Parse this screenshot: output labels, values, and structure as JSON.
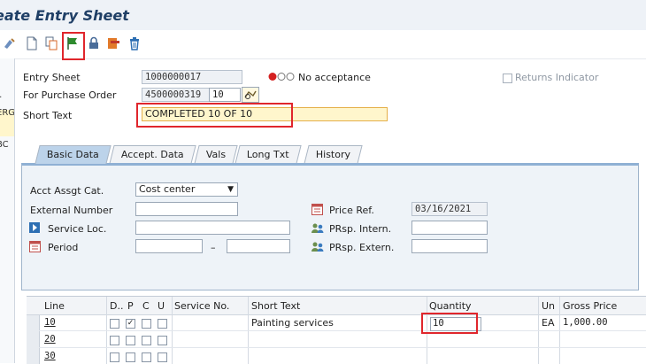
{
  "window": {
    "title": "eate Entry Sheet"
  },
  "left_panel": {
    "items": [
      "..",
      "ERG",
      "BC"
    ]
  },
  "header": {
    "entry_sheet_label": "Entry Sheet",
    "entry_sheet_value": "1000000017",
    "acceptance_status": "No acceptance",
    "returns_indicator_label": "Returns Indicator",
    "po_label": "For Purchase Order",
    "po_number": "4500000319",
    "po_item": "10",
    "short_text_label": "Short Text",
    "short_text_value": "COMPLETED 10 OF 10"
  },
  "tabs": [
    {
      "label": "Basic Data",
      "active": true
    },
    {
      "label": "Accept. Data",
      "active": false
    },
    {
      "label": "Vals",
      "active": false
    },
    {
      "label": "Long Txt",
      "active": false
    },
    {
      "label": "History",
      "active": false
    }
  ],
  "basic_data": {
    "acct_assgt_label": "Acct Assgt Cat.",
    "acct_assgt_value": "Cost center",
    "external_number_label": "External Number",
    "external_number_value": "",
    "service_loc_label": "Service Loc.",
    "service_loc_value": "",
    "period_label": "Period",
    "period_dash": "–",
    "period_from": "",
    "period_to": "",
    "price_ref_label": "Price Ref.",
    "price_ref_value": "03/16/2021",
    "prsp_intern_label": "PRsp. Intern.",
    "prsp_intern_value": "",
    "prsp_extern_label": "PRsp. Extern.",
    "prsp_extern_value": ""
  },
  "table": {
    "columns": [
      "Line",
      "D..",
      "P",
      "C",
      "U",
      "Service No.",
      "Short Text",
      "Quantity",
      "Un",
      "Gross Price"
    ],
    "rows": [
      {
        "line": "10",
        "p_checked": true,
        "service_no": "",
        "short_text": "Painting services",
        "quantity": "10",
        "unit": "EA",
        "gross_price": "1,000.00"
      },
      {
        "line": "20",
        "p_checked": false,
        "service_no": "",
        "short_text": "",
        "quantity": "",
        "unit": "",
        "gross_price": ""
      },
      {
        "line": "30",
        "p_checked": false,
        "service_no": "",
        "short_text": "",
        "quantity": "",
        "unit": "",
        "gross_price": ""
      }
    ]
  },
  "icons": [
    "display-change-icon",
    "new-document-icon",
    "copy-icon",
    "accept-flag-icon",
    "lock-icon",
    "revoke-acceptance-icon",
    "delete-icon",
    "search-help-icon",
    "price-ref-icon",
    "service-loc-icon",
    "period-icon",
    "person-intern-icon",
    "person-extern-icon"
  ],
  "colors": {
    "highlight": "#e0262c",
    "field_focus": "#fff6cc",
    "title": "#1f3f66",
    "tab_active": "#bcd3ea",
    "flag_green": "#2e8b2e"
  }
}
